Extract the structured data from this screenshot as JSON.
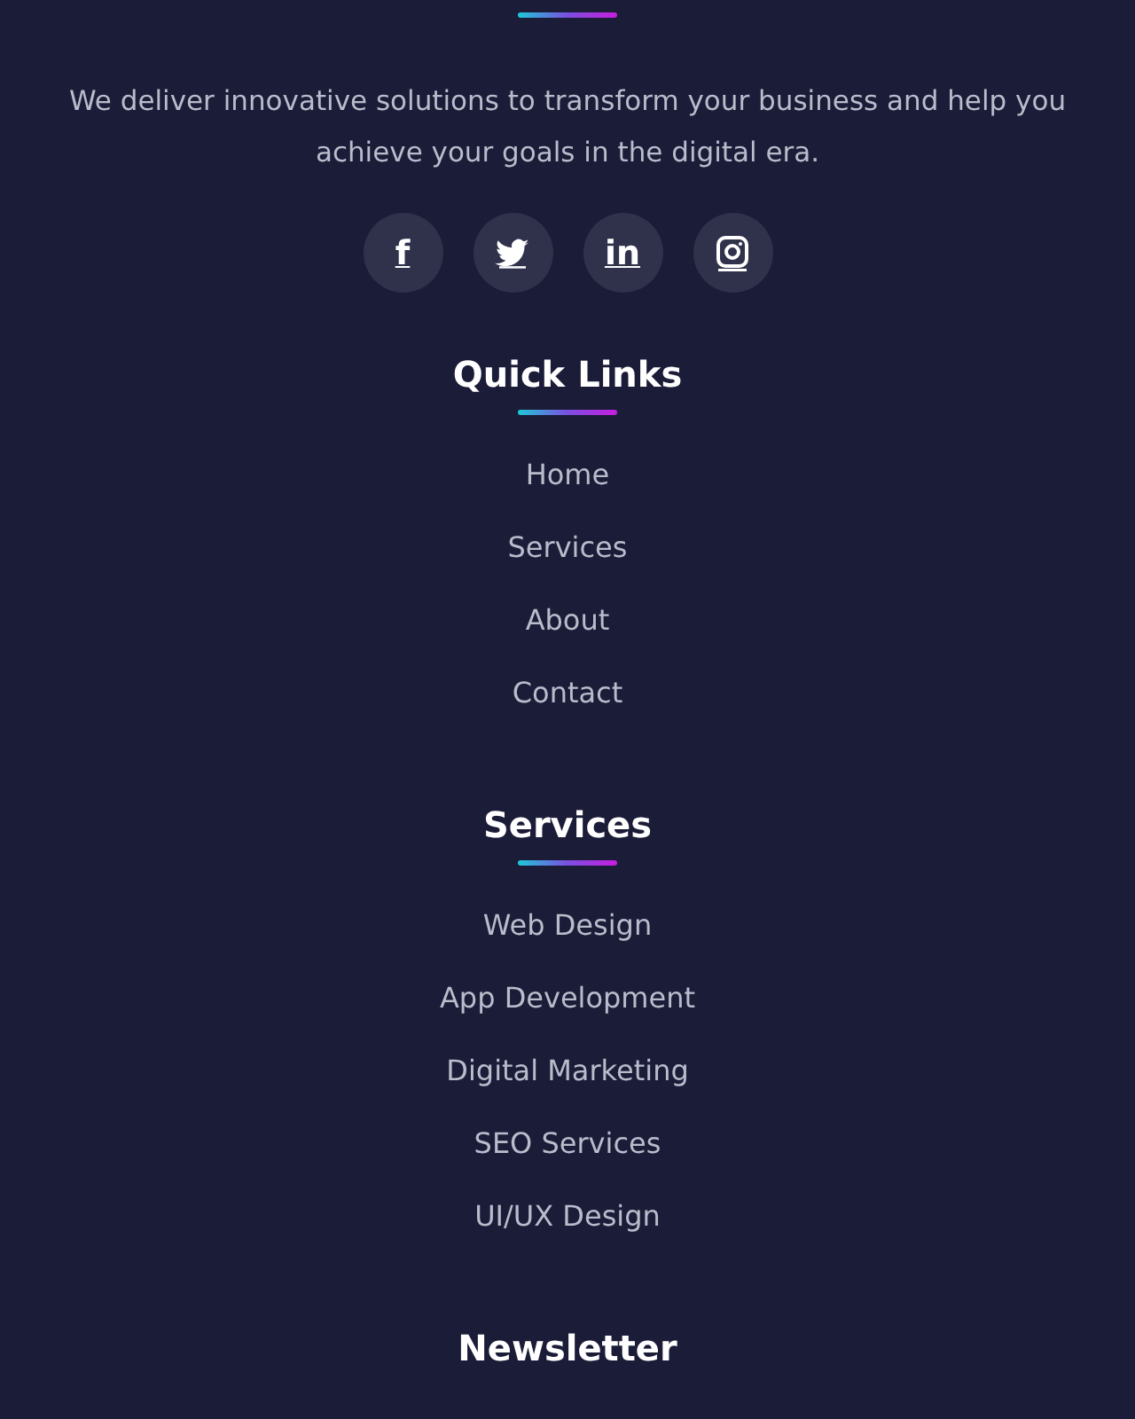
{
  "about": {
    "text": "We deliver innovative solutions to transform your business and help you achieve your goals in the digital era."
  },
  "socials": [
    {
      "kind": "letter",
      "label": "f"
    },
    {
      "kind": "bird"
    },
    {
      "kind": "letter",
      "label": "in"
    },
    {
      "kind": "camera"
    }
  ],
  "sections": [
    {
      "title": "Quick Links",
      "links": [
        "Home",
        "Services",
        "About",
        "Contact"
      ]
    },
    {
      "title": "Services",
      "links": [
        "Web Design",
        "App Development",
        "Digital Marketing",
        "SEO Services",
        "UI/UX Design"
      ]
    },
    {
      "title": "Newsletter"
    }
  ]
}
